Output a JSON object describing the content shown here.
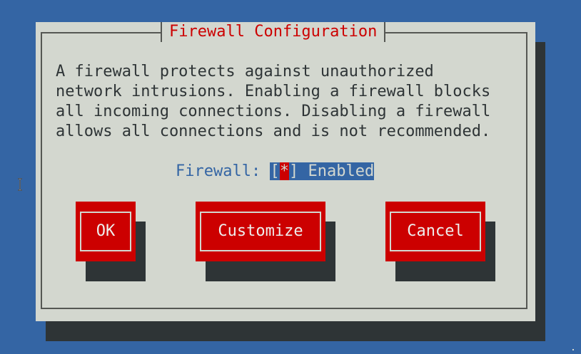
{
  "dialog": {
    "title": "Firewall Configuration",
    "description": "A firewall protects against unauthorized\nnetwork intrusions. Enabling a firewall blocks\nall incoming connections. Disabling a firewall\nallows all connections and is not recommended.",
    "firewall_label": "Firewall:",
    "checkbox_open": "[",
    "checkbox_mark": "*",
    "checkbox_close": "]",
    "checkbox_text": "Enabled"
  },
  "buttons": {
    "ok": "OK",
    "customize": "Customize",
    "cancel": "Cancel"
  },
  "colors": {
    "desktop": "#3465a4",
    "dialog": "#d3d7cf",
    "button": "#cc0000",
    "title": "#cc0000",
    "shadow": "#2e3436"
  },
  "icons": {
    "cursor": "text-cursor-icon"
  }
}
